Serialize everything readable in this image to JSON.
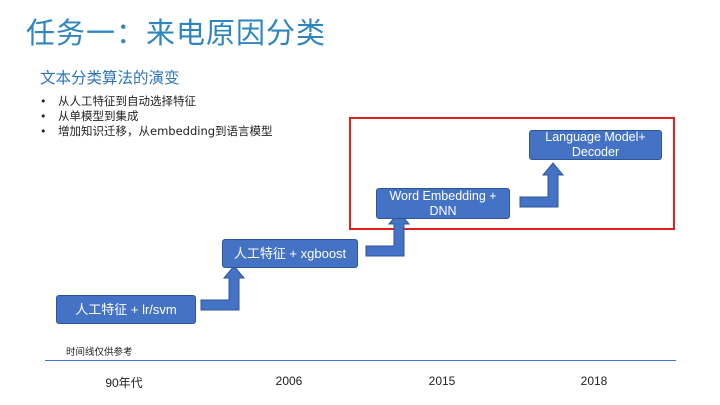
{
  "slide": {
    "title": "任务一：来电原因分类",
    "subtitle": "文本分类算法的演变",
    "bullets": [
      "从人工特征到自动选择特征",
      "从单模型到集成",
      "增加知识迁移，从embedding到语言模型"
    ],
    "bullet_symbol": "•",
    "note": "时间线仅供参考"
  },
  "diagram": {
    "stages": [
      {
        "label": "人工特征 + lr/svm"
      },
      {
        "label": "人工特征 + xgboost"
      },
      {
        "label": "Word Embedding +\nDNN"
      },
      {
        "label": "Language Model+\nDecoder"
      }
    ],
    "timeline": [
      "90年代",
      "2006",
      "2015",
      "2018"
    ],
    "colors": {
      "box_fill": "#4472c4",
      "box_border": "#2f5597",
      "highlight_frame": "#e0201b",
      "title": "#2e86c1"
    }
  }
}
